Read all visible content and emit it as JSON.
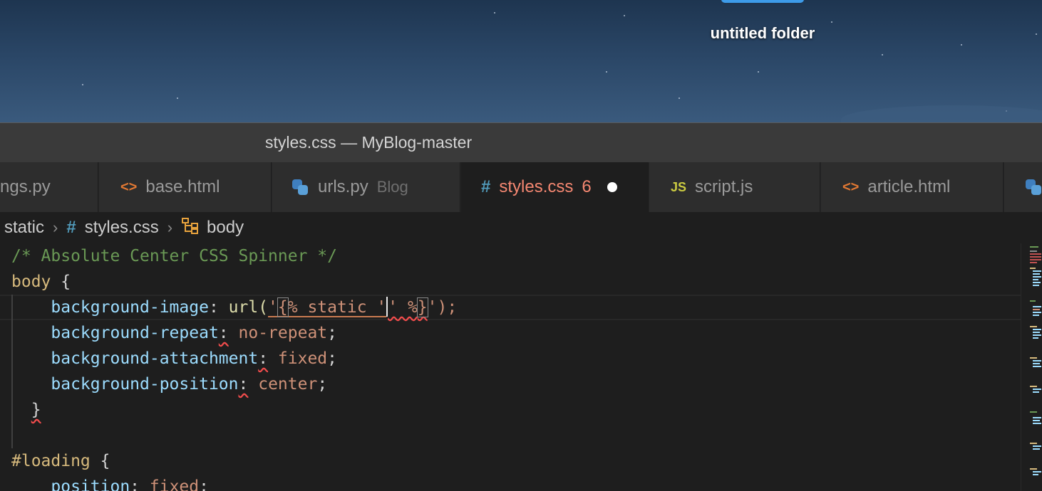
{
  "desktop": {
    "folder_label": "untitled folder"
  },
  "window": {
    "title": "styles.css — MyBlog-master"
  },
  "tabs": [
    {
      "label": "ngs.py",
      "icon": "python-icon"
    },
    {
      "label": "base.html",
      "icon": "html-icon"
    },
    {
      "label": "urls.py",
      "description": "Blog",
      "icon": "python-icon"
    },
    {
      "label": "styles.css",
      "problem_count": "6",
      "icon": "css-hash-icon",
      "modified": true,
      "active": true
    },
    {
      "label": "script.js",
      "icon": "js-icon"
    },
    {
      "label": "article.html",
      "icon": "html-icon"
    }
  ],
  "icons": {
    "html_glyph": "<>",
    "css_glyph": "#",
    "js_glyph": "JS"
  },
  "breadcrumb": {
    "folder": "static",
    "file": "styles.css",
    "symbol": "body"
  },
  "code": {
    "comment": "/* Absolute Center CSS Spinner */",
    "selector_body": "body",
    "open_brace": " {",
    "close_brace": "}",
    "line3": {
      "prop": "background-image",
      "fn": "url(",
      "quote": "'",
      "tpl_open": "{",
      "str1": "% static '",
      "str2": "' %",
      "tpl_close": "}",
      "end": "');"
    },
    "line4": {
      "prop": "background-repeat",
      "value": "no-repeat"
    },
    "line5": {
      "prop": "background-attachment",
      "value": "fixed"
    },
    "line6": {
      "prop": "background-position",
      "value": "center"
    },
    "selector_loading": "#loading",
    "line9": {
      "prop": "position",
      "value": "fixed"
    }
  },
  "colors": {
    "active_tab_label": "#f48771",
    "comment": "#6a9955",
    "selector": "#d7ba7d",
    "property": "#9cdcfe",
    "value": "#ce9178",
    "error_squiggle": "#f14c4c"
  }
}
